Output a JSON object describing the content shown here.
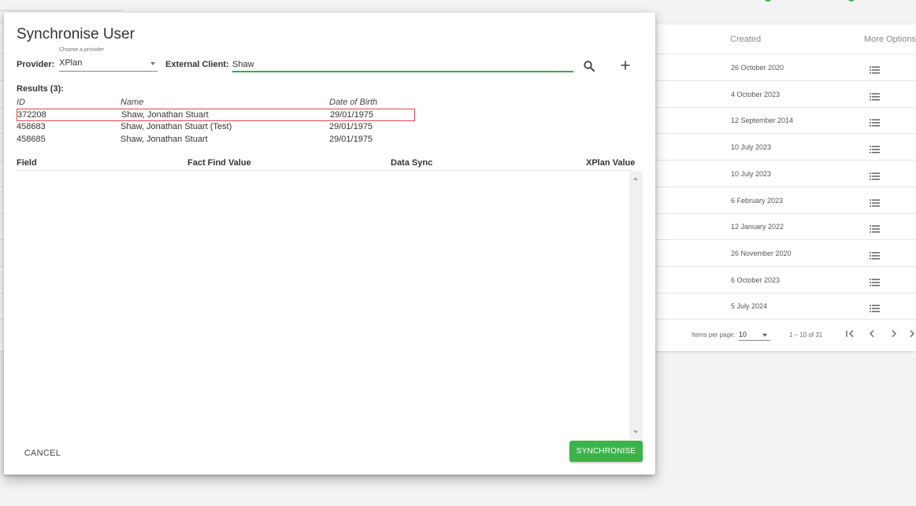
{
  "background": {
    "columns": {
      "created": "Created",
      "more_options": "More Options"
    },
    "rows": [
      {
        "created": "26 October 2020"
      },
      {
        "created": "4 October 2023"
      },
      {
        "created": "12 September 2014"
      },
      {
        "created": "10 July 2023"
      },
      {
        "created": "10 July 2023"
      },
      {
        "created": "6 February 2023"
      },
      {
        "created": "12 January 2022"
      },
      {
        "created": "26 November 2020"
      },
      {
        "created": "6 October 2023"
      },
      {
        "created": "5 July 2024"
      }
    ],
    "paginator": {
      "items_per_page_label": "Items per page:",
      "items_per_page": "10",
      "range": "1 – 10 of 31"
    },
    "icons": {
      "row_options": "list-icon",
      "first_page": "first-page-icon",
      "prev_page": "chevron-left-icon",
      "next_page": "chevron-right-icon",
      "last_page": "last-page-icon"
    }
  },
  "dialog": {
    "title": "Synchronise User",
    "provider": {
      "label": "Provider:",
      "hint": "Choose a provider",
      "value": "XPlan"
    },
    "external_client": {
      "label": "External Client:",
      "value": "Shaw"
    },
    "icons": {
      "search": "search-icon",
      "add": "plus-icon"
    },
    "results": {
      "label": "Results (3):",
      "headers": {
        "id": "ID",
        "name": "Name",
        "dob": "Date of Birth"
      },
      "rows": [
        {
          "id": "372208",
          "name": "Shaw, Jonathan Stuart",
          "dob": "29/01/1975",
          "selected": true
        },
        {
          "id": "458683",
          "name": "Shaw, Jonathan Stuart (Test)",
          "dob": "29/01/1975",
          "selected": false
        },
        {
          "id": "458685",
          "name": "Shaw, Jonathan Stuart",
          "dob": "29/01/1975",
          "selected": false
        }
      ]
    },
    "sync_table": {
      "headers": {
        "field": "Field",
        "fact_find": "Fact Find Value",
        "data_sync": "Data Sync",
        "xplan": "XPlan Value"
      }
    },
    "buttons": {
      "cancel": "CANCEL",
      "synchronise": "SYNCHRONISE"
    }
  },
  "colors": {
    "accent_green": "#3bb34a",
    "input_underline": "#3aa55b",
    "selection_border": "#e0454b"
  }
}
